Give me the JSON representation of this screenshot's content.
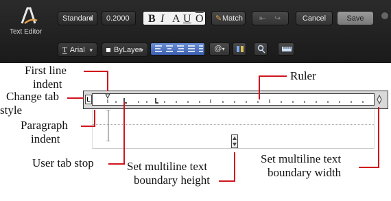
{
  "toolbar": {
    "app_label": "Text Editor",
    "style_value": "Standard",
    "height_value": "0.2000",
    "format_bold": "B",
    "format_italic": "I",
    "format_caps": "A",
    "format_underline": "U",
    "format_overline": "O",
    "match_label": "Match",
    "cancel_label": "Cancel",
    "save_label": "Save",
    "font_value": "Arial",
    "color_value": "ByLayer",
    "at_symbol": "@",
    "font_icon_letter": "T"
  },
  "callouts": {
    "first_line_indent": "First line indent",
    "first_line_1": "First line",
    "first_line_2": "indent",
    "ruler": "Ruler",
    "change_tab_1": "Change tab",
    "change_tab_2": "style",
    "paragraph_1": "Paragraph",
    "paragraph_2": "indent",
    "user_tab": "User tab stop",
    "height_1": "Set multiline text",
    "height_2": "boundary height",
    "width_1": "Set multiline text",
    "width_2": "boundary width"
  },
  "colors": {
    "toolbar_bg": "#1f1f1f",
    "callout_line": "#d0141c",
    "save_button": "#8a8a8a"
  },
  "icons": {
    "text_editor": "text-editor-a-icon",
    "match": "paintbrush-icon",
    "undo": "undo-arrow-icon",
    "redo": "redo-arrow-icon",
    "close": "close-icon",
    "tab_style": "tab-style-L-icon",
    "boundary_height": "height-handle-icon",
    "boundary_width": "width-handle-icon"
  }
}
